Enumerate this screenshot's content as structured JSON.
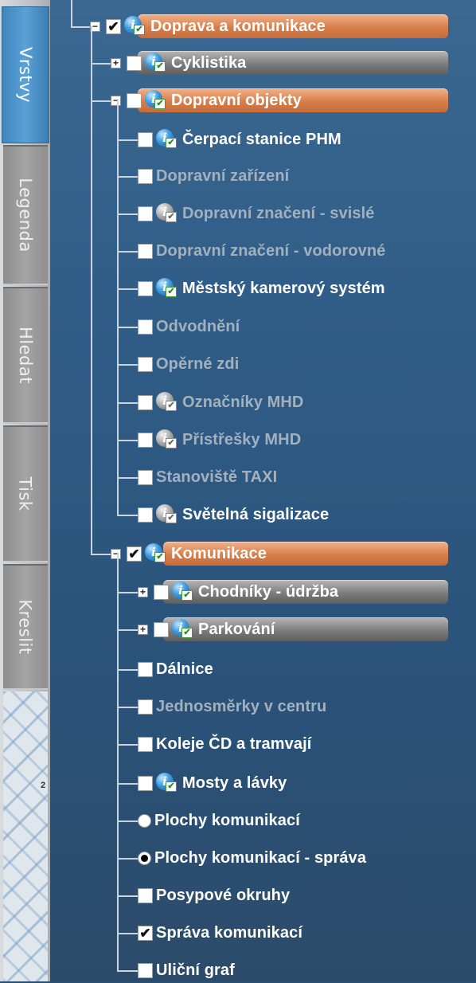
{
  "tabs": [
    {
      "label": "Vrstvy",
      "active": true
    },
    {
      "label": "Legenda",
      "active": false
    },
    {
      "label": "Hledat",
      "active": false
    },
    {
      "label": "Tisk",
      "active": false
    },
    {
      "label": "Kreslit",
      "active": false
    }
  ],
  "map_thumb_label": "2",
  "icon_glyph": "i",
  "check_glyph": "✔",
  "expand_glyph": "+",
  "collapse_glyph": "−",
  "colors": {
    "group_header": "#d77f4b",
    "subgroup_header": "#7c7c7c",
    "enabled_text": "#ffffff",
    "disabled_text": "#a3b1be",
    "tab_active": "#4a93cb"
  },
  "tree": {
    "group": {
      "label": "Doprava a komunikace",
      "checked": true,
      "expanded": true
    },
    "cyklistika": {
      "label": "Cyklistika",
      "checked": false,
      "expanded": false
    },
    "objekty": {
      "label": "Dopravní objekty",
      "checked": false,
      "expanded": true,
      "items": [
        {
          "label": "Čerpací stanice PHM",
          "icon": "info-icon",
          "enabled": true
        },
        {
          "label": "Dopravní zařízení",
          "icon": null,
          "enabled": false
        },
        {
          "label": "Dopravní značení - svislé",
          "icon": "info-icon-disabled",
          "enabled": false
        },
        {
          "label": "Dopravní značení - vodorovné",
          "icon": null,
          "enabled": false
        },
        {
          "label": "Městský kamerový systém",
          "icon": "info-icon",
          "enabled": true
        },
        {
          "label": "Odvodnění",
          "icon": null,
          "enabled": false
        },
        {
          "label": "Opěrné zdi",
          "icon": null,
          "enabled": false
        },
        {
          "label": "Označníky MHD",
          "icon": "info-icon-disabled",
          "enabled": false
        },
        {
          "label": "Přístřešky MHD",
          "icon": "info-icon-disabled",
          "enabled": false
        },
        {
          "label": "Stanoviště TAXI",
          "icon": null,
          "enabled": false
        },
        {
          "label": "Světelná sigalizace",
          "icon": "info-icon-disabled",
          "enabled": true
        }
      ]
    },
    "komunikace": {
      "label": "Komunikace",
      "checked": true,
      "expanded": true,
      "subgroups": [
        {
          "label": "Chodníky - údržba",
          "checked": false,
          "expanded": false
        },
        {
          "label": "Parkování",
          "checked": false,
          "expanded": false
        }
      ],
      "items": [
        {
          "label": "Dálnice",
          "control": "checkbox",
          "checked": false,
          "icon": null,
          "enabled": true
        },
        {
          "label": "Jednosměrky v centru",
          "control": "checkbox",
          "checked": false,
          "icon": null,
          "enabled": false
        },
        {
          "label": "Koleje ČD a tramvají",
          "control": "checkbox",
          "checked": false,
          "icon": null,
          "enabled": true
        },
        {
          "label": "Mosty a lávky",
          "control": "checkbox",
          "checked": false,
          "icon": "info-icon",
          "enabled": true
        },
        {
          "label": "Plochy komunikací",
          "control": "radio",
          "checked": false,
          "icon": null,
          "enabled": true
        },
        {
          "label": "Plochy komunikací - správa",
          "control": "radio",
          "checked": true,
          "icon": null,
          "enabled": true
        },
        {
          "label": "Posypové okruhy",
          "control": "checkbox",
          "checked": false,
          "icon": null,
          "enabled": true
        },
        {
          "label": "Správa komunikací",
          "control": "checkbox",
          "checked": true,
          "icon": null,
          "enabled": true
        },
        {
          "label": "Uliční graf",
          "control": "checkbox",
          "checked": false,
          "icon": null,
          "enabled": true
        }
      ]
    }
  }
}
